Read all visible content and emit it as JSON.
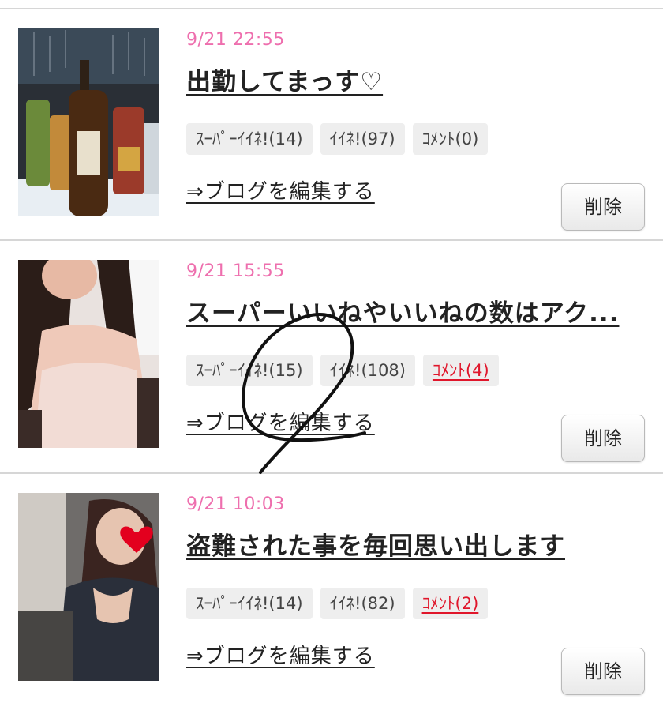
{
  "entries": [
    {
      "date": "9/21 22:55",
      "title": "出勤してまっす♡",
      "tags": {
        "super_like": "ｽｰﾊﾟｰｲｲﾈ!(14)",
        "like": "ｲｲﾈ!(97)",
        "comment": "ｺﾒﾝﾄ(0)"
      },
      "comment_active": false,
      "edit_link": "⇒ブログを編集する",
      "delete_label": "削除",
      "thumbnail": "whisky-bottles-photo"
    },
    {
      "date": "9/21 15:55",
      "title": "スーパーいいねやいいねの数はアク...",
      "tags": {
        "super_like": "ｽｰﾊﾟｰｲｲﾈ!(15)",
        "like": "ｲｲﾈ!(108)",
        "comment": "ｺﾒﾝﾄ(4)"
      },
      "comment_active": true,
      "edit_link": "⇒ブログを編集する",
      "delete_label": "削除",
      "thumbnail": "woman-white-dress-photo"
    },
    {
      "date": "9/21 10:03",
      "title": "盗難された事を毎回思い出します",
      "tags": {
        "super_like": "ｽｰﾊﾟｰｲｲﾈ!(14)",
        "like": "ｲｲﾈ!(82)",
        "comment": "ｺﾒﾝﾄ(2)"
      },
      "comment_active": true,
      "edit_link": "⇒ブログを編集する",
      "delete_label": "削除",
      "thumbnail": "woman-car-heart-sticker-photo"
    }
  ],
  "colors": {
    "date": "#ee6fae",
    "comment_active": "#e0162b",
    "tag_bg": "#eeeeee"
  }
}
